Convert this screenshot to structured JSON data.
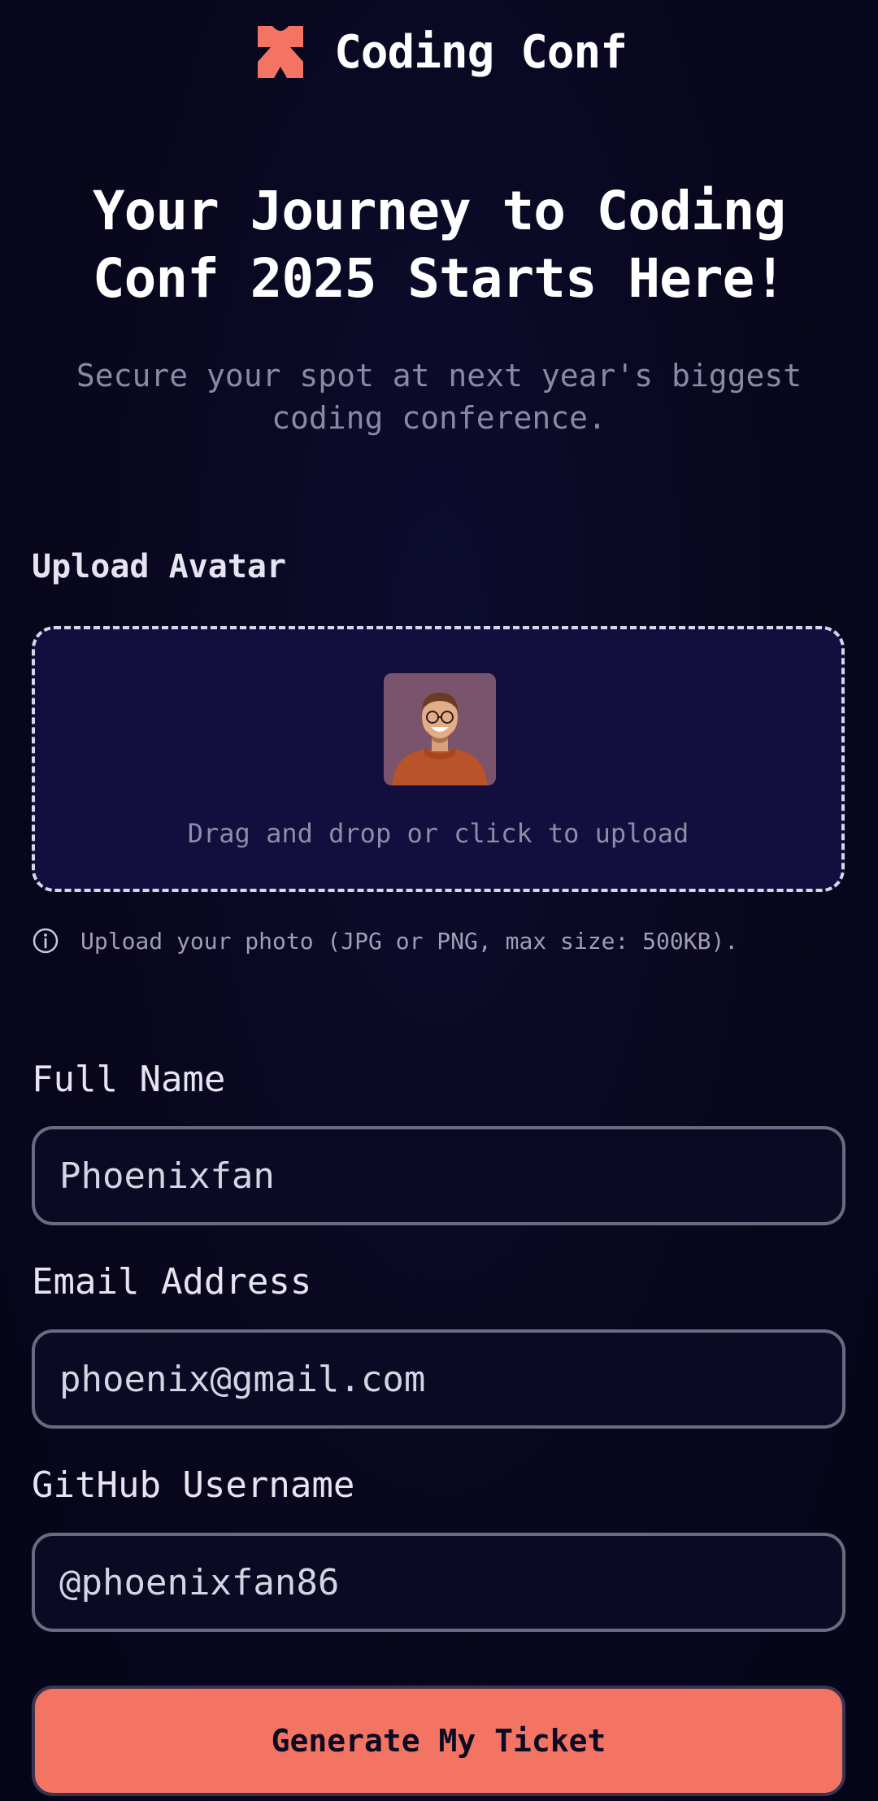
{
  "header": {
    "brand_name": "Coding Conf",
    "logo_icon": "coding-conf-logo-icon"
  },
  "hero": {
    "title": "Your Journey to Coding Conf 2025 Starts Here!",
    "subtitle": "Secure your spot at next year's biggest coding conference."
  },
  "avatar_upload": {
    "label": "Upload Avatar",
    "hint": "Drag and drop or click to upload",
    "info_icon": "info-icon",
    "info_text": "Upload your photo (JPG or PNG, max size: 500KB)."
  },
  "form": {
    "full_name": {
      "label": "Full Name",
      "value": "Phoenixfan"
    },
    "email": {
      "label": "Email Address",
      "value": "phoenix@gmail.com"
    },
    "github": {
      "label": "GitHub Username",
      "value": "@phoenixfan86"
    },
    "submit_label": "Generate My Ticket"
  },
  "colors": {
    "accent": "#f37462",
    "background": "#08071d",
    "upload_zone": "#120f3e",
    "muted_text": "#8a88a3"
  }
}
